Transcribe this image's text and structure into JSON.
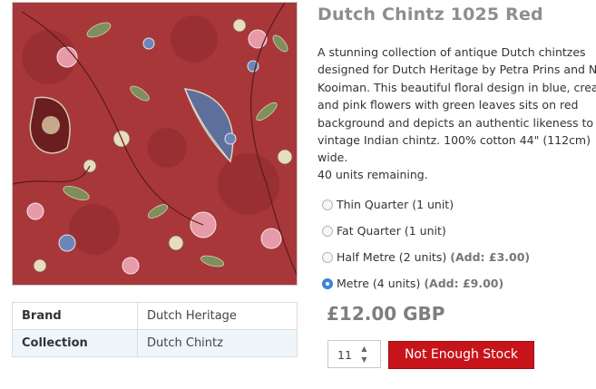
{
  "product": {
    "title": "Dutch Chintz 1025 Red",
    "image_name": "fabric-swatch-image",
    "description": "A stunning collection of antique Dutch chintzes designed for Dutch Heritage by Petra Prins and Nel Kooiman. This beautiful floral design in blue, cream and pink flowers with green leaves sits on red background and depicts an authentic likeness to vintage Indian chintz. 100% cotton 44\" (112cm) wide.",
    "stock_text": "40 units remaining.",
    "price": "£12.00 GBP"
  },
  "specs": [
    {
      "key": "Brand",
      "value": "Dutch Heritage"
    },
    {
      "key": "Collection",
      "value": "Dutch Chintz"
    }
  ],
  "options": [
    {
      "label": "Thin Quarter (1 unit)",
      "add": "",
      "checked": false
    },
    {
      "label": "Fat Quarter (1 unit)",
      "add": "",
      "checked": false
    },
    {
      "label": "Half Metre (2 units)",
      "add": "(Add: £3.00)",
      "checked": false
    },
    {
      "label": "Metre (4 units)",
      "add": "(Add: £9.00)",
      "checked": true
    }
  ],
  "quantity": {
    "value": "11"
  },
  "cart_button": {
    "label": "Not Enough Stock"
  },
  "colors": {
    "fabric_background": "#a8373a",
    "button": "#c7141a",
    "radio_checked": "#3f86db"
  }
}
